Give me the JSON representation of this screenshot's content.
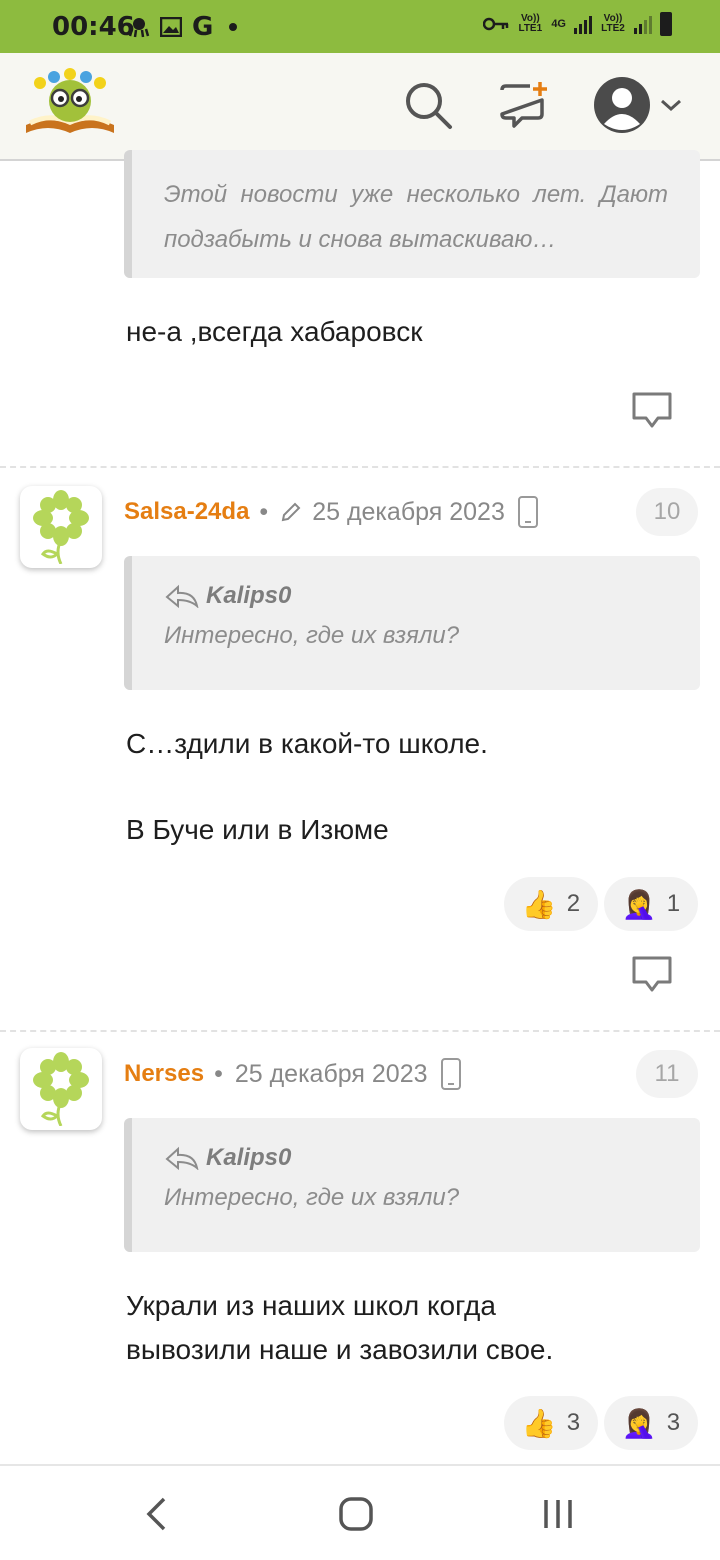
{
  "status_bar": {
    "time": "00:46",
    "icons": [
      "octopus-icon",
      "image-icon",
      "google-icon",
      "dot-icon"
    ],
    "g_label": "G",
    "sim1_label": "Vo)) LTE1",
    "net_label": "4G",
    "sim2_label": "Vo)) LTE2"
  },
  "header": {
    "icons": [
      "search-icon",
      "new-comment-icon",
      "user-avatar-icon",
      "chevron-down-icon"
    ]
  },
  "comments": [
    {
      "quote_text": "Этой новости уже несколько лет. Дают подзабыть и снова вытаскиваю…",
      "text": "не-а ,всегда хабаровск"
    },
    {
      "author": "Salsa-24da",
      "date": "25 декабря 2023",
      "edited": true,
      "number": "10",
      "quote_author": "Kalips0",
      "quote_text": "Интересно, где их взяли?",
      "lines": [
        "С…здили в какой-то школе.",
        "В Буче или в Изюме"
      ],
      "reactions": [
        {
          "emoji": "👍",
          "count": "2"
        },
        {
          "emoji": "🤦‍♀️",
          "count": "1"
        }
      ]
    },
    {
      "author": "Nerses",
      "date": "25 декабря 2023",
      "edited": false,
      "number": "11",
      "quote_author": "Kalips0",
      "quote_text": "Интересно, где их взяли?",
      "lines": [
        "Украли из наших школ когда",
        "вывозили наше и завозили свое."
      ],
      "reactions": [
        {
          "emoji": "👍",
          "count": "3"
        },
        {
          "emoji": "🤦‍♀️",
          "count": "3"
        }
      ]
    }
  ],
  "nav": {
    "icons": [
      "back-icon",
      "home-icon",
      "recents-icon"
    ]
  },
  "colors": {
    "status_bar": "#8dbb3f",
    "username": "#e57e12",
    "quote_bg": "#f0f0f0"
  }
}
